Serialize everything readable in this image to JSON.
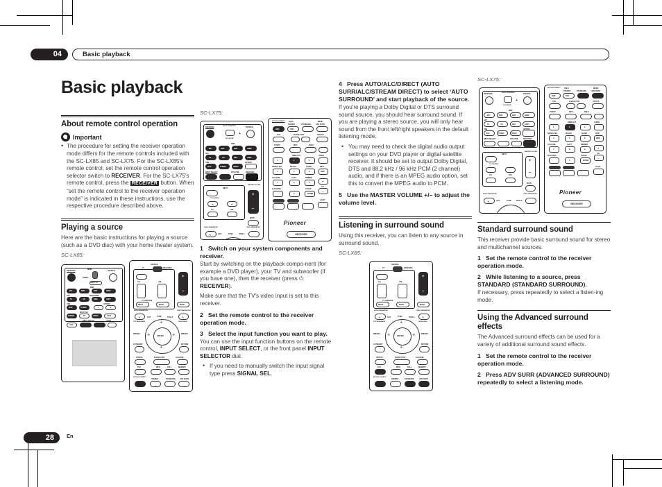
{
  "header": {
    "chapter": "04",
    "title": "Basic playback"
  },
  "page_title": "Basic playback",
  "footer": {
    "page_number": "28",
    "language": "En"
  },
  "col1": {
    "s1_title": "About remote control operation",
    "important_label": "Important",
    "important_bullet": "The procedure for setting the receiver operation mode differs for the remote controls included with the SC-LX85 and SC-LX75. For the SC-LX85's remote control, set the remote control operation selector switch to RECEIVER. For the SC-LX75's remote control, press the RECEIVER button. When “set the remote control to the receiver operation mode” is indicated in these instructions, use the respective procedure described above.",
    "imp_part1": "The procedure for setting the receiver operation mode differs for the remote controls included with the SC-LX85 and SC-LX75. For the SC-LX85's remote control, set the remote control operation selector switch to ",
    "imp_key1": "RECEIVER",
    "imp_part2": ". For the SC-LX75's remote control, press the ",
    "imp_key2": "RECEIVER",
    "imp_part3": " button. When “set the remote control to the receiver operation mode” is indicated in these instructions, use the respective procedure described above.",
    "s2_title": "Playing a source",
    "s2_body": "Here are the basic instructions for playing a source (such as a DVD disc) with your home theater system.",
    "model": "SC-LX85:"
  },
  "col2": {
    "model": "SC-LX75:",
    "step1_num": "1",
    "step1_title": "Switch on your system components and receiver.",
    "step1_b1": "Start by switching on the playback compo-nent (for example a DVD player), your TV and subwoofer (if you have one), then the receiver (press ⏻ ",
    "step1_key": "RECEIVER",
    "step1_b1end": ").",
    "step1_b2": "Make sure that the TV's video input is set to this receiver.",
    "step2_num": "2",
    "step2_title": "Set the remote control to the receiver operation mode.",
    "step3_num": "3",
    "step3_title": "Select the input function you want to play.",
    "step3_b1": "You can use the input function buttons on the remote control, ",
    "step3_key1": "INPUT SELECT",
    "step3_b1mid": ", or the front panel ",
    "step3_key2": "INPUT SELECTOR",
    "step3_b1end": " dial.",
    "step3_bullet_a": "If you need to manually switch the input signal type press ",
    "step3_bullet_key": "SIGNAL SEL",
    "step3_bullet_end": "."
  },
  "col3": {
    "step4_num": "4",
    "step4_title": "Press AUTO/ALC/DIRECT (AUTO SURR/ALC/STREAM DIRECT) to select ‘AUTO SURROUND’ and start playback of the source.",
    "step4_body": "If you're playing a Dolby Digital or DTS surround sound source, you should hear surround sound. If you are playing a stereo source, you will only hear sound from the front left/right speakers in the default listening mode.",
    "step4_bullet": "You may need to check the digital audio output settings on your DVD player or digital satellite receiver. It should be set to output Dolby Digital, DTS and 88.2 kHz / 96 kHz PCM (2 channel) audio, and if there is an MPEG audio option, set this to convert the MPEG audio to PCM.",
    "step5_num": "5",
    "step5_title": "Use the MASTER VOLUME +/– to adjust the volume level.",
    "s_title": "Listening in surround sound",
    "s_body": "Using this receiver, you can listen to any source in surround sound.",
    "model": "SC-LX85:"
  },
  "col4": {
    "model": "SC-LX75:",
    "s1_title": "Standard surround sound",
    "s1_body": "This receiver provide basic surround sound for stereo and multichannel sources.",
    "s1_step1_num": "1",
    "s1_step1_title": "Set the remote control to the receiver operation mode.",
    "s1_step2_num": "2",
    "s1_step2_title": "While listening to a source, press STANDARD (STANDARD SURROUND).",
    "s1_step2_body": "If necessary, press repeatedly to select a listen-ing mode.",
    "s2_title": "Using the Advanced surround effects",
    "s2_body": "The Advanced surround effects can be used for a variety of additional surround sound effects.",
    "s2_step1_num": "1",
    "s2_step1_title": "Set the remote control to the receiver operation mode.",
    "s2_step2_num": "2",
    "s2_step2_title": "Press ADV SURR (ADVANCED SURROUND) repeatedly to select a listening mode."
  },
  "remote_common": {
    "brand": "Pioneer",
    "receiver_badge": "RECEIVER",
    "labels": {
      "receiver": "RECEIVER",
      "multi_operation": "MULTI OPERATION",
      "source": "SOURCE",
      "rcu_setup": "RCU SETUP",
      "main": "MAIN",
      "zone2": "ZONE2",
      "bdr": "BDR",
      "sat": "SAT",
      "usb": "USB",
      "net_radio": "NET RADIO",
      "option": "OPTION",
      "multich": "MULTI CH",
      "input_select": "INPUT SELECT",
      "sts_ctrl": "STS CTRL",
      "hdd_dvr": "HDD/DVR",
      "light": "LIGHT",
      "input": "INPUT",
      "tv_control": "TV CONTROL",
      "master_volume": "MASTER VOLUME",
      "ch": "CH",
      "vol": "VOL",
      "mute": "MUTE",
      "audio_parameter": "AUDIO PARAMETER",
      "video_parameter": "VIDEO PARAMETER",
      "list": "LIST",
      "tune": "TUNE",
      "tools": "TOOLS",
      "top_menu_band": "TOP MENU/BAND",
      "home_menu": "HOME MENU",
      "preset": "PRESET",
      "category": "CATEGORY",
      "return": "RETURN",
      "enter": "ENTER",
      "status": "STATUS",
      "phase_ctrl": "PHASE CTRL",
      "ch_level": "CH LEVEL",
      "thx": "THX",
      "info": "INFO",
      "full": "FULL",
      "memory": "MEMORY",
      "auto_alc_direct": "AUTO/ALC/DIRECT",
      "pqls": "PQLS",
      "stereo": "STEREO",
      "standard": "STANDARD",
      "adv_surr": "ADV SURR",
      "menu": "MENU",
      "tv_dtv": "TV/DTV",
      "mpx": "MPX",
      "hdmi_out": "HDMI OUT",
      "audio": "AUDIO",
      "signal_sel": "SIGNAL SEL",
      "mcacc": "MCACC",
      "sleep": "SLEEP",
      "disp": "DISP",
      "a_att": "A.ATT",
      "dimmer": "DIMMER",
      "d_access": "D.ACCESS",
      "clear": "CLEAR",
      "hdg": "HDG",
      "adpt": "ADPT",
      "bd": "BD",
      "dvd": "DVD",
      "dvr": "DVR",
      "hdmi": "HDMI",
      "tv": "TV",
      "cd": "CD",
      "rec": "REC",
      "ipod": "iPod",
      "tuner": "TUNER",
      "video": "VIDEO",
      "phono": "PHONO",
      "in": "IN",
      "cdr": "CD-R",
      "aux": "AUX",
      "num1": "1",
      "num2": "2",
      "num3": "3",
      "num4": "4",
      "num5": "5",
      "num6": "6",
      "num7": "7",
      "num8": "8",
      "num9": "9",
      "num0": "0"
    }
  }
}
